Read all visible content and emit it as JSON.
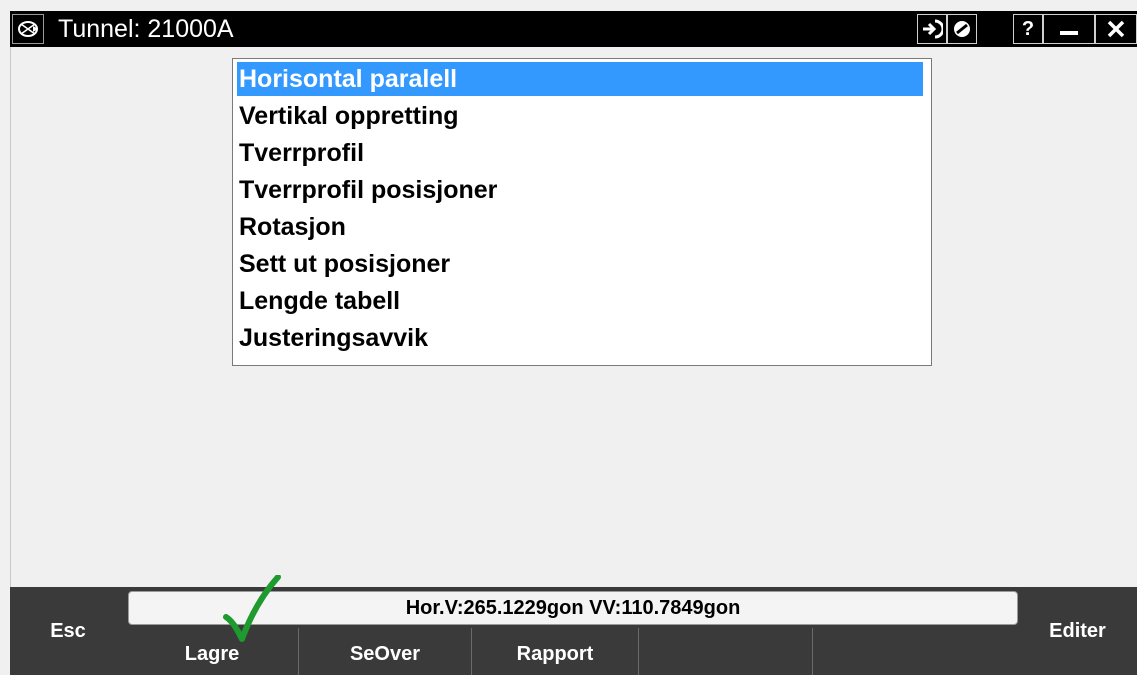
{
  "window": {
    "title": "Tunnel: 21000A"
  },
  "list": {
    "items": [
      {
        "label": "Horisontal paralell",
        "selected": true
      },
      {
        "label": "Vertikal oppretting"
      },
      {
        "label": "Tverrprofil"
      },
      {
        "label": "Tverrprofil posisjoner"
      },
      {
        "label": "Rotasjon"
      },
      {
        "label": "Sett ut posisjoner"
      },
      {
        "label": "Lengde tabell"
      },
      {
        "label": "Justeringsavvik"
      }
    ]
  },
  "status": {
    "text": "Hor.V:265.1229gon  VV:110.7849gon"
  },
  "softkeys": {
    "esc": "Esc",
    "lagre": "Lagre",
    "seover": "SeOver",
    "rapport": "Rapport",
    "editer": "Editer"
  },
  "titlebar_buttons": {
    "help": "?"
  },
  "colors": {
    "selection": "#3399ff",
    "titlebar": "#000000",
    "softkey_bar": "#3a3a3a",
    "checkmark": "#1e9a2e"
  },
  "icons": [
    "app-menu-icon",
    "login-arrow-icon",
    "no-entry-icon",
    "help-icon",
    "minimize-icon",
    "close-icon",
    "checkmark-icon"
  ]
}
